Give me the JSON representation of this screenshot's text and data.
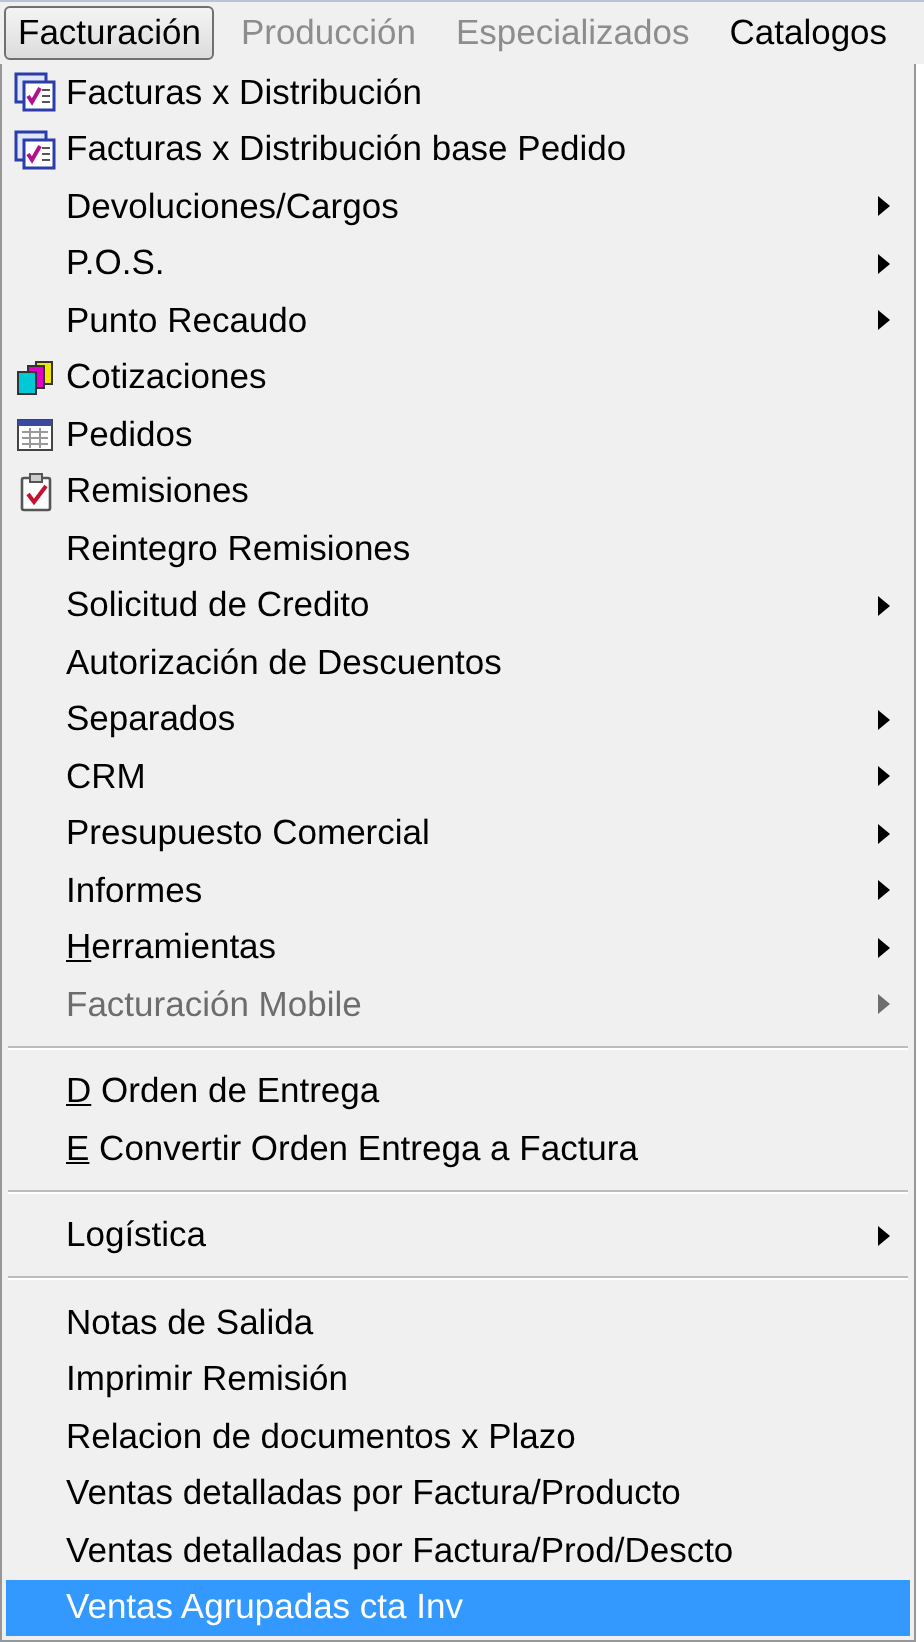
{
  "menubar": [
    {
      "label": "Facturación",
      "selected": true,
      "disabled": false
    },
    {
      "label": "Producción",
      "selected": false,
      "disabled": true
    },
    {
      "label": "Especializados",
      "selected": false,
      "disabled": true
    },
    {
      "label": "Catalogos",
      "selected": false,
      "disabled": false
    }
  ],
  "menu": {
    "sections": [
      [
        {
          "label": "Facturas x Distribución",
          "kind": "checklist",
          "submenu": false,
          "disabled": false,
          "selected": false,
          "underline_first": false
        },
        {
          "label": "Facturas x Distribución base Pedido",
          "kind": "checklist",
          "submenu": false,
          "disabled": false,
          "selected": false,
          "underline_first": false
        },
        {
          "label": "Devoluciones/Cargos",
          "kind": "plain",
          "submenu": true,
          "disabled": false,
          "selected": false,
          "underline_first": false
        },
        {
          "label": "P.O.S.",
          "kind": "plain",
          "submenu": true,
          "disabled": false,
          "selected": false,
          "underline_first": false
        },
        {
          "label": "Punto Recaudo",
          "kind": "plain",
          "submenu": true,
          "disabled": false,
          "selected": false,
          "underline_first": false
        },
        {
          "label": "Cotizaciones",
          "kind": "cubes",
          "submenu": false,
          "disabled": false,
          "selected": false,
          "underline_first": false
        },
        {
          "label": "Pedidos",
          "kind": "table",
          "submenu": false,
          "disabled": false,
          "selected": false,
          "underline_first": false
        },
        {
          "label": "Remisiones",
          "kind": "clipboard",
          "submenu": false,
          "disabled": false,
          "selected": false,
          "underline_first": false
        },
        {
          "label": "Reintegro Remisiones",
          "kind": "plain",
          "submenu": false,
          "disabled": false,
          "selected": false,
          "underline_first": false
        },
        {
          "label": "Solicitud de Credito",
          "kind": "plain",
          "submenu": true,
          "disabled": false,
          "selected": false,
          "underline_first": false
        },
        {
          "label": "Autorización de Descuentos",
          "kind": "plain",
          "submenu": false,
          "disabled": false,
          "selected": false,
          "underline_first": false
        },
        {
          "label": "Separados",
          "kind": "plain",
          "submenu": true,
          "disabled": false,
          "selected": false,
          "underline_first": false
        },
        {
          "label": "CRM",
          "kind": "plain",
          "submenu": true,
          "disabled": false,
          "selected": false,
          "underline_first": false
        },
        {
          "label": "Presupuesto Comercial",
          "kind": "plain",
          "submenu": true,
          "disabled": false,
          "selected": false,
          "underline_first": false
        },
        {
          "label": "Informes",
          "kind": "plain",
          "submenu": true,
          "disabled": false,
          "selected": false,
          "underline_first": false
        },
        {
          "label": "Herramientas",
          "kind": "plain",
          "submenu": true,
          "disabled": false,
          "selected": false,
          "underline_first": true
        },
        {
          "label": "Facturación Mobile",
          "kind": "plain",
          "submenu": true,
          "disabled": true,
          "selected": false,
          "underline_first": false
        }
      ],
      [
        {
          "label": "D Orden de Entrega",
          "kind": "plain",
          "submenu": false,
          "disabled": false,
          "selected": false,
          "underline_first": true
        },
        {
          "label": "E Convertir Orden Entrega a Factura",
          "kind": "plain",
          "submenu": false,
          "disabled": false,
          "selected": false,
          "underline_first": true
        }
      ],
      [
        {
          "label": "Logística",
          "kind": "plain",
          "submenu": true,
          "disabled": false,
          "selected": false,
          "underline_first": false
        }
      ],
      [
        {
          "label": "Notas de Salida",
          "kind": "plain",
          "submenu": false,
          "disabled": false,
          "selected": false,
          "underline_first": false
        },
        {
          "label": "Imprimir Remisión",
          "kind": "plain",
          "submenu": false,
          "disabled": false,
          "selected": false,
          "underline_first": false
        },
        {
          "label": "Relacion de documentos x Plazo",
          "kind": "plain",
          "submenu": false,
          "disabled": false,
          "selected": false,
          "underline_first": false
        },
        {
          "label": "Ventas detalladas por Factura/Producto",
          "kind": "plain",
          "submenu": false,
          "disabled": false,
          "selected": false,
          "underline_first": false
        },
        {
          "label": "Ventas detalladas por Factura/Prod/Descto",
          "kind": "plain",
          "submenu": false,
          "disabled": false,
          "selected": false,
          "underline_first": false
        },
        {
          "label": "Ventas Agrupadas cta Inv",
          "kind": "plain",
          "submenu": false,
          "disabled": false,
          "selected": true,
          "underline_first": false
        }
      ]
    ]
  }
}
